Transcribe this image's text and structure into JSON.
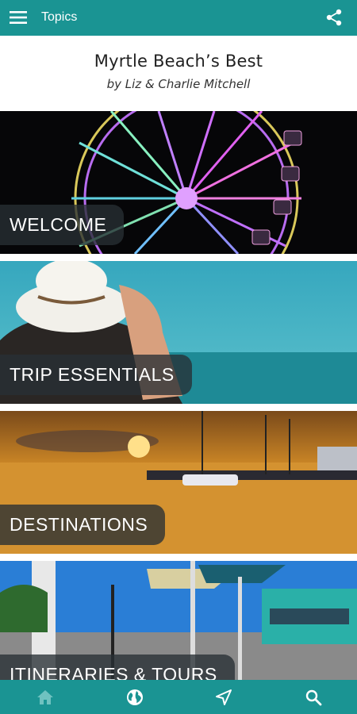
{
  "appbar": {
    "title": "Topics",
    "menu_icon": "menu-icon",
    "share_icon": "share-icon"
  },
  "header": {
    "title": "Myrtle Beach’s Best",
    "subtitle": "by Liz & Charlie Mitchell"
  },
  "topics": [
    {
      "label": "WELCOME"
    },
    {
      "label": "TRIP ESSENTIALS"
    },
    {
      "label": "DESTINATIONS"
    },
    {
      "label": "ITINERARIES & TOURS"
    }
  ],
  "bottom_nav": [
    "home-icon",
    "globe-icon",
    "navigation-arrow-icon",
    "search-icon"
  ],
  "colors": {
    "accent": "#1a9493"
  }
}
